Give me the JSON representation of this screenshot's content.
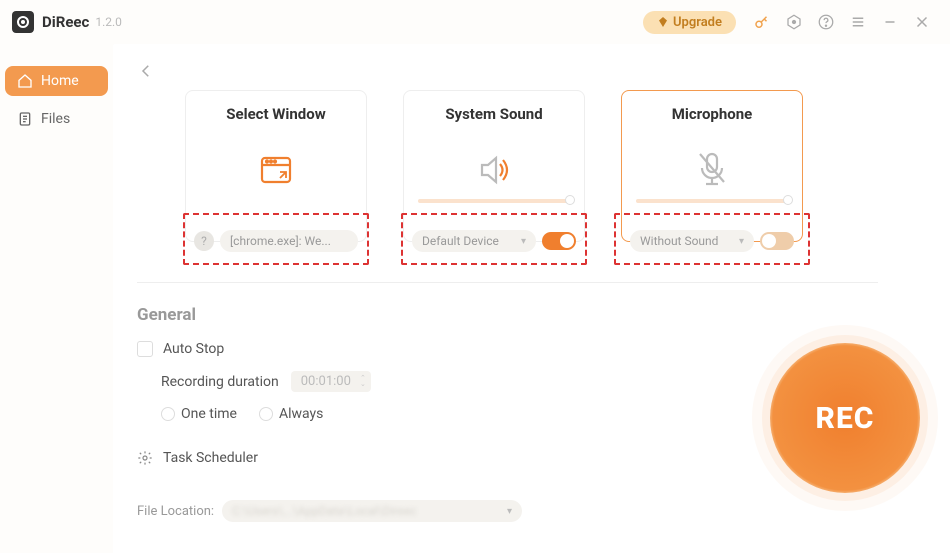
{
  "app": {
    "name": "DiReec",
    "version": "1.2.0"
  },
  "titlebar": {
    "upgrade": "Upgrade"
  },
  "sidebar": {
    "items": [
      {
        "label": "Home"
      },
      {
        "label": "Files"
      }
    ]
  },
  "cards": {
    "window": {
      "title": "Select Window",
      "value": "[chrome.exe]: We..."
    },
    "system": {
      "title": "System Sound",
      "value": "Default Device",
      "toggle": true
    },
    "mic": {
      "title": "Microphone",
      "value": "Without Sound",
      "toggle": false
    }
  },
  "general": {
    "heading": "General",
    "autoStop": "Auto Stop",
    "durationLabel": "Recording duration",
    "durationValue": "00:01:00",
    "oneTime": "One time",
    "always": "Always",
    "taskScheduler": "Task Scheduler",
    "fileLocationLabel": "File Location:",
    "fileLocationValue": "C:\\Users\\...\\AppData\\Local\\Direec"
  },
  "rec": {
    "label": "REC"
  }
}
